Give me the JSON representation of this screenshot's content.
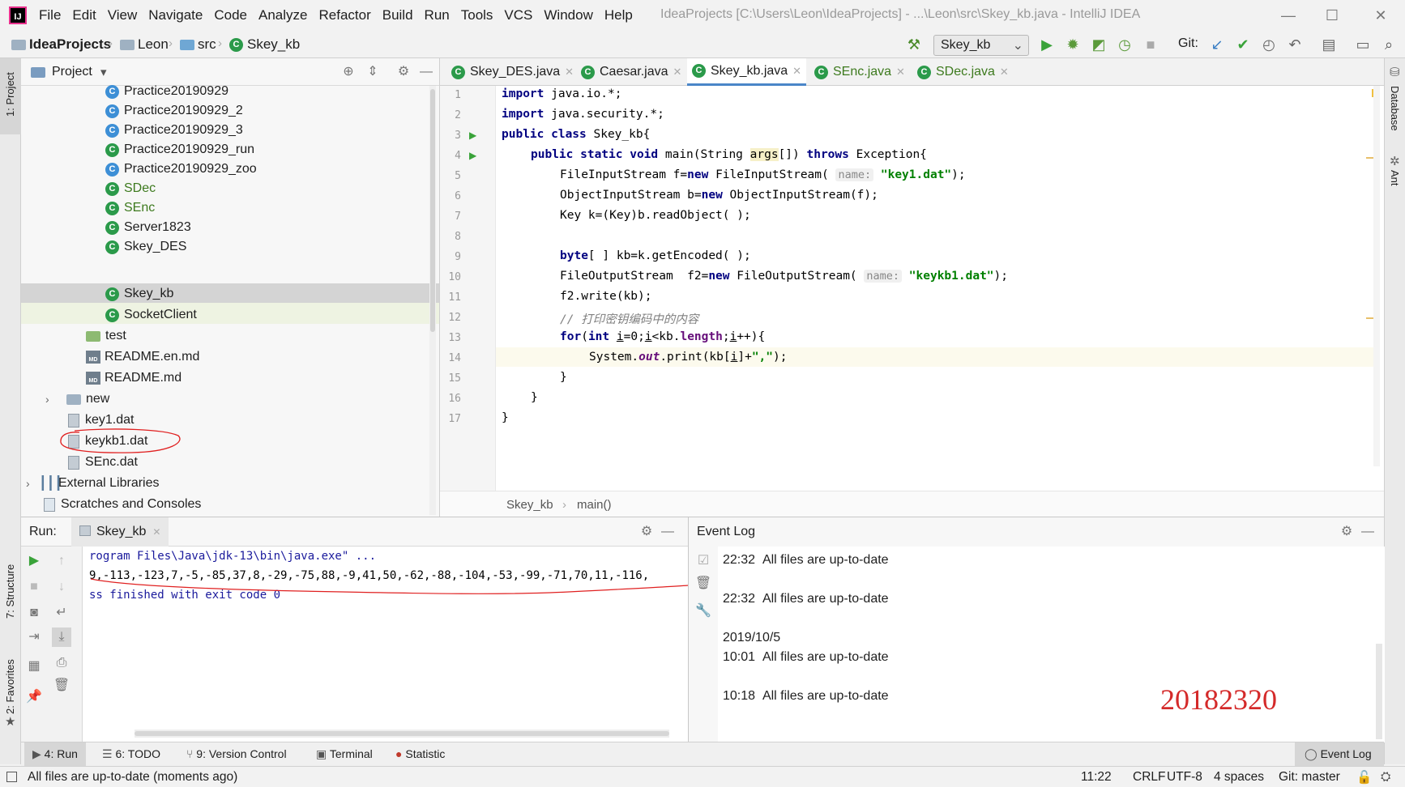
{
  "menu": {
    "items": [
      "File",
      "Edit",
      "View",
      "Navigate",
      "Code",
      "Analyze",
      "Refactor",
      "Build",
      "Run",
      "Tools",
      "VCS",
      "Window",
      "Help"
    ]
  },
  "window_title": "IdeaProjects [C:\\Users\\Leon\\IdeaProjects] - ...\\Leon\\src\\Skey_kb.java - IntelliJ IDEA",
  "breadcrumb": {
    "root": "IdeaProjects",
    "folder1": "Leon",
    "folder2": "src",
    "file": "Skey_kb"
  },
  "toolbar": {
    "run_config": "Skey_kb",
    "git_label": "Git:"
  },
  "left_strip": {
    "project": "1: Project",
    "structure": "7: Structure",
    "favorites": "2: Favorites"
  },
  "right_strip": {
    "database": "Database",
    "ant": "Ant"
  },
  "project": {
    "title": "Project",
    "tree": [
      {
        "label": "Practice20190929",
        "kind": "class"
      },
      {
        "label": "Practice20190929_2",
        "kind": "class"
      },
      {
        "label": "Practice20190929_3",
        "kind": "class"
      },
      {
        "label": "Practice20190929_run",
        "kind": "runclass"
      },
      {
        "label": "Practice20190929_zoo",
        "kind": "class"
      },
      {
        "label": "SDec",
        "kind": "runclass"
      },
      {
        "label": "SEnc",
        "kind": "runclass"
      },
      {
        "label": "Server1823",
        "kind": "runclass"
      },
      {
        "label": "Skey_DES",
        "kind": "runclass"
      },
      {
        "label": "Skey_kb",
        "kind": "runclass"
      },
      {
        "label": "SocketClient",
        "kind": "runclass"
      },
      {
        "label": "test",
        "kind": "folder"
      },
      {
        "label": "README.en.md",
        "kind": "md"
      },
      {
        "label": "README.md",
        "kind": "md"
      },
      {
        "label": "new",
        "kind": "folder"
      },
      {
        "label": "key1.dat",
        "kind": "file"
      },
      {
        "label": "keykb1.dat",
        "kind": "file"
      },
      {
        "label": "SEnc.dat",
        "kind": "file"
      },
      {
        "label": "External Libraries",
        "kind": "lib"
      },
      {
        "label": "Scratches and Consoles",
        "kind": "scratch"
      }
    ]
  },
  "editor": {
    "tabs": [
      "Skey_DES.java",
      "Caesar.java",
      "Skey_kb.java",
      "SEnc.java",
      "SDec.java"
    ],
    "active_tab": "Skey_kb.java",
    "line_numbers": [
      "1",
      "2",
      "3",
      "4",
      "5",
      "6",
      "7",
      "8",
      "9",
      "10",
      "11",
      "12",
      "13",
      "14",
      "15",
      "16",
      "17"
    ],
    "code": {
      "l1": [
        "import",
        " java.io.*;"
      ],
      "l2": [
        "import",
        " java.security.*;"
      ],
      "l3": [
        "public class",
        " Skey_kb{"
      ],
      "l4": [
        "public static void",
        " main(String ",
        "args",
        "[]) ",
        "throws",
        " Exception{"
      ],
      "l5": [
        "FileInputStream f=",
        "new",
        " FileInputStream( ",
        "name:",
        " ",
        "\"key1.dat\"",
        ");"
      ],
      "l6": [
        "ObjectInputStream b=",
        "new",
        " ObjectInputStream(f);"
      ],
      "l7": [
        "Key k=(Key)b.readObject( );"
      ],
      "l9": [
        "byte",
        "[ ] kb=k.getEncoded( );"
      ],
      "l10": [
        "FileOutputStream  f2=",
        "new",
        " FileOutputStream( ",
        "name:",
        " ",
        "\"keykb1.dat\"",
        ");"
      ],
      "l11": [
        "f2.write(kb);"
      ],
      "l12": [
        "// 打印密钥编码中的内容"
      ],
      "l13": [
        "for",
        "(",
        "int",
        " ",
        "i",
        "=0;",
        "i",
        "<kb.",
        "length",
        ";",
        "i",
        "++){"
      ],
      "l14": [
        "System.",
        "out",
        ".print(kb[",
        "i",
        "]+",
        "\",\"",
        ");"
      ],
      "l15": [
        "}"
      ],
      "l16": [
        "}"
      ],
      "l17": [
        "}"
      ]
    },
    "breadcrumbs": [
      "Skey_kb",
      "main()"
    ]
  },
  "run": {
    "label": "Run:",
    "tab": "Skey_kb",
    "console": [
      "rogram Files\\Java\\jdk-13\\bin\\java.exe\" ...",
      "9,-113,-123,7,-5,-85,37,8,-29,-75,88,-9,41,50,-62,-88,-104,-53,-99,-71,70,11,-116,",
      "ss finished with exit code 0"
    ]
  },
  "event_log": {
    "title": "Event Log",
    "entries": [
      {
        "date": "",
        "time": "22:32",
        "text": "All files are up-to-date"
      },
      {
        "date": "",
        "time": "22:32",
        "text": "All files are up-to-date"
      },
      {
        "date": "2019/10/5",
        "time": "10:01",
        "text": "All files are up-to-date"
      },
      {
        "date": "",
        "time": "10:18",
        "text": "All files are up-to-date"
      }
    ],
    "watermark": "20182320"
  },
  "bottom_tabs": {
    "run": "4: Run",
    "todo": "6: TODO",
    "vcs": "9: Version Control",
    "terminal": "Terminal",
    "statistic": "Statistic",
    "eventlog": "Event Log"
  },
  "status": {
    "message": "All files are up-to-date (moments ago)",
    "position": "11:22",
    "line_sep": "CRLF",
    "encoding": "UTF-8",
    "indent": "4 spaces",
    "git": "Git: master"
  },
  "colors": {
    "accent": "#4a86c8",
    "annotation": "#e02020",
    "watermark": "#d42a2a"
  }
}
